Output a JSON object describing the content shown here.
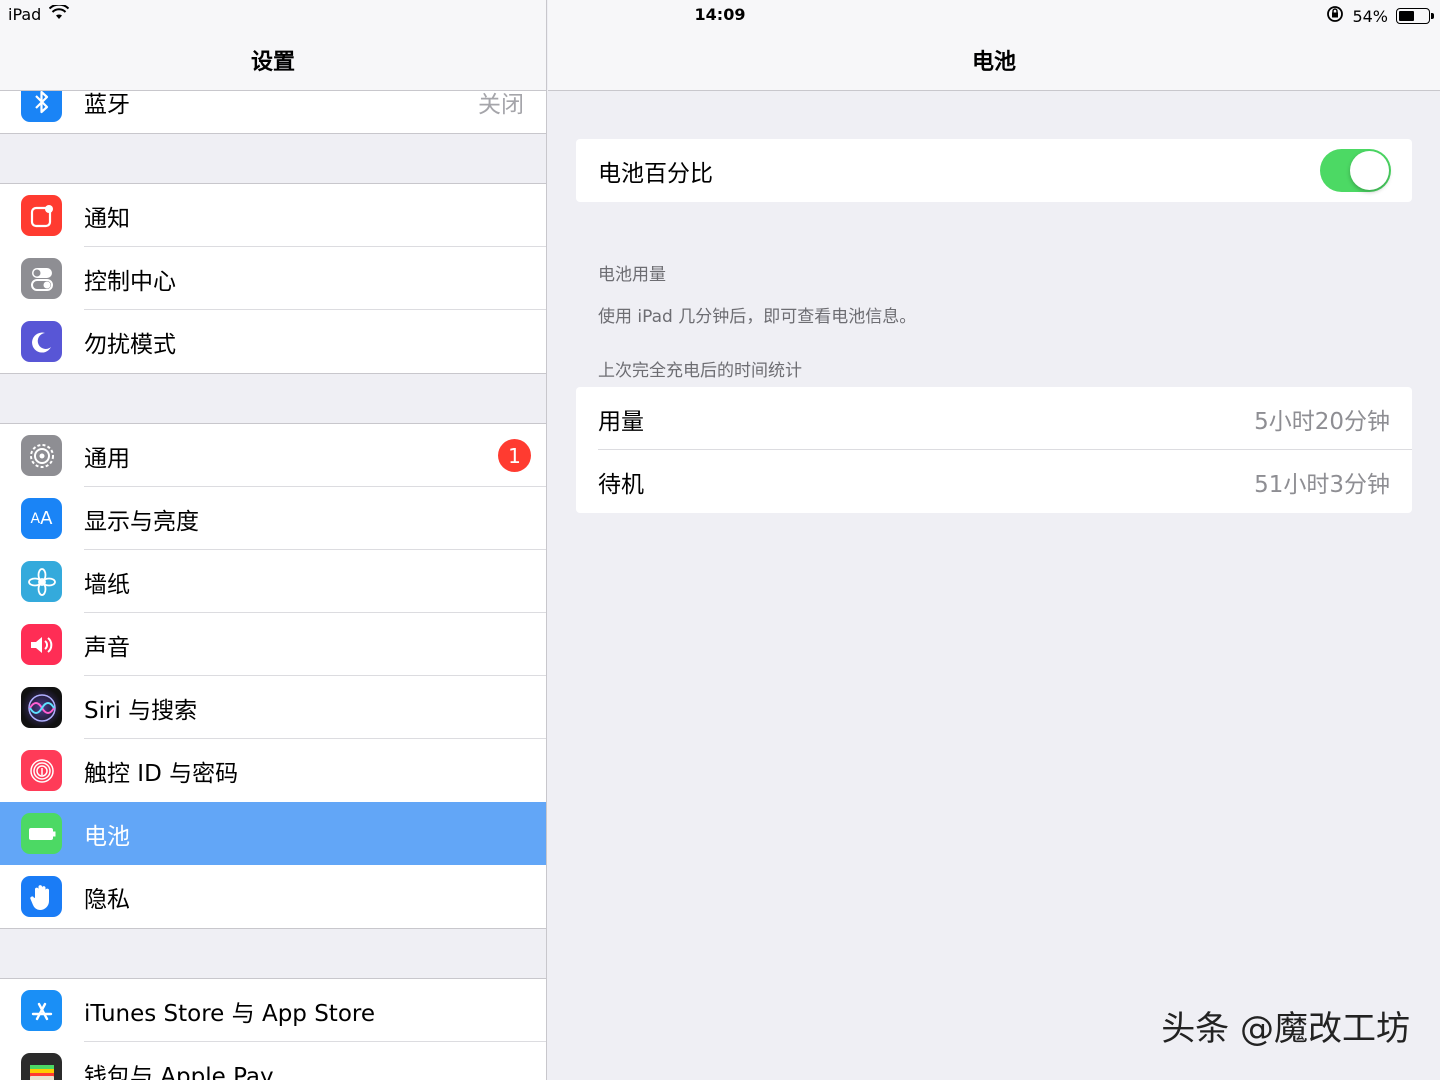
{
  "status": {
    "device": "iPad",
    "time": "14:09",
    "battery_percent": "54%",
    "battery_level": 0.54
  },
  "left": {
    "title": "设置",
    "bluetooth": {
      "label": "蓝牙",
      "value": "关闭"
    },
    "group1": [
      {
        "label": "通知",
        "color": "#ff3b30",
        "icon": "notification-icon"
      },
      {
        "label": "控制中心",
        "color": "#8e8e93",
        "icon": "control-center-icon"
      },
      {
        "label": "勿扰模式",
        "color": "#5856d6",
        "icon": "moon-icon"
      }
    ],
    "general": {
      "label": "通用",
      "badge": "1"
    },
    "group2": [
      {
        "label": "显示与亮度",
        "color": "#1a84f6",
        "icon": "display-icon",
        "glyph": "AA"
      },
      {
        "label": "墙纸",
        "color": "#34aadc",
        "icon": "wallpaper-icon",
        "glyph": "❀"
      },
      {
        "label": "声音",
        "color": "#ff2d55",
        "icon": "sound-icon",
        "glyph": "🔊"
      },
      {
        "label": "Siri 与搜索",
        "color": "#2c2c3a",
        "icon": "siri-icon",
        "glyph": "◉"
      },
      {
        "label": "触控 ID 与密码",
        "color": "#ff3b58",
        "icon": "fingerprint-icon",
        "glyph": "◎"
      },
      {
        "label": "电池",
        "color": "#4cd964",
        "icon": "battery-icon",
        "glyph": "▬"
      },
      {
        "label": "隐私",
        "color": "#1a7cf6",
        "icon": "privacy-hand-icon",
        "glyph": "✋"
      }
    ],
    "group3": [
      {
        "label": "iTunes Store 与 App Store",
        "color": "#1a8ff6",
        "icon": "app-store-icon",
        "glyph": "A"
      },
      {
        "label": "钱包与 Apple Pay",
        "color": "#2b2b2b",
        "icon": "wallet-icon",
        "glyph": "▤"
      }
    ]
  },
  "right": {
    "title": "电池",
    "battery_percentage": {
      "label": "电池百分比",
      "on": true
    },
    "usage_header": "电池用量",
    "usage_note": "使用 iPad 几分钟后，即可查看电池信息。",
    "stats_header": "上次完全充电后的时间统计",
    "stats": [
      {
        "label": "用量",
        "value": "5小时20分钟"
      },
      {
        "label": "待机",
        "value": "51小时3分钟"
      }
    ]
  },
  "watermark": "头条 @魔改工坊"
}
